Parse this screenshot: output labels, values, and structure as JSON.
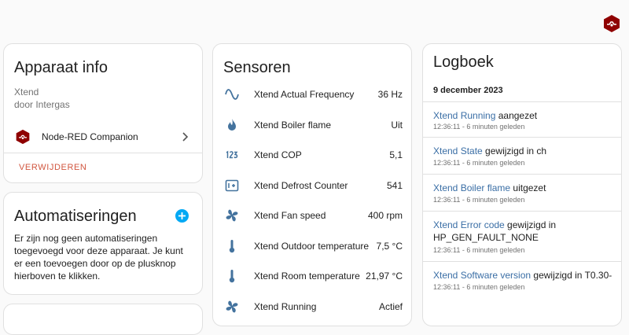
{
  "header": {
    "logo_icon": "node-red-hex-icon"
  },
  "device_info": {
    "title": "Apparaat info",
    "model": "Xtend",
    "manufacturer": "door Intergas",
    "integration": {
      "label": "Node-RED Companion",
      "icon": "node-red-hex-icon"
    },
    "delete_label": "VERWIJDEREN"
  },
  "automations": {
    "title": "Automatiseringen",
    "empty_text": "Er zijn nog geen automatiseringen toegevoegd voor deze apparaat. Je kunt er een toevoegen door op de plusknop hierboven te klikken."
  },
  "sensors": {
    "title": "Sensoren",
    "items": [
      {
        "icon": "sine-wave-icon",
        "name": "Xtend Actual Frequency",
        "value": "36 Hz"
      },
      {
        "icon": "fire-icon",
        "name": "Xtend Boiler flame",
        "value": "Uit"
      },
      {
        "icon": "numeric-icon",
        "name": "Xtend COP",
        "value": "5,1"
      },
      {
        "icon": "counter-icon",
        "name": "Xtend Defrost Counter",
        "value": "541"
      },
      {
        "icon": "fan-icon",
        "name": "Xtend Fan speed",
        "value": "400 rpm"
      },
      {
        "icon": "thermometer-icon",
        "name": "Xtend Outdoor temperature",
        "value": "7,5 °C"
      },
      {
        "icon": "thermometer-icon",
        "name": "Xtend Room temperature",
        "value": "21,97 °C"
      },
      {
        "icon": "fan-icon",
        "name": "Xtend Running",
        "value": "Actief"
      }
    ]
  },
  "logbook": {
    "title": "Logboek",
    "date": "9 december 2023",
    "entries": [
      {
        "entity": "Xtend Running",
        "message": " aangezet",
        "time": "12:36:11 - 6 minuten geleden"
      },
      {
        "entity": "Xtend State",
        "message": " gewijzigd in ch",
        "time": "12:36:11 - 6 minuten geleden"
      },
      {
        "entity": "Xtend Boiler flame",
        "message": " uitgezet",
        "time": "12:36:11 - 6 minuten geleden"
      },
      {
        "entity": "Xtend Error code",
        "message": " gewijzigd in HP_GEN_FAULT_NONE",
        "time": "12:36:11 - 6 minuten geleden"
      },
      {
        "entity": "Xtend Software version",
        "message": " gewijzigd in T0.30-",
        "time": "12:36:11 - 6 minuten geleden"
      }
    ]
  },
  "colors": {
    "accent": "#03a9f4",
    "icon": "#44739e",
    "link": "#3a6ea5",
    "danger": "#d1563f",
    "node_red": "#8f0000"
  }
}
